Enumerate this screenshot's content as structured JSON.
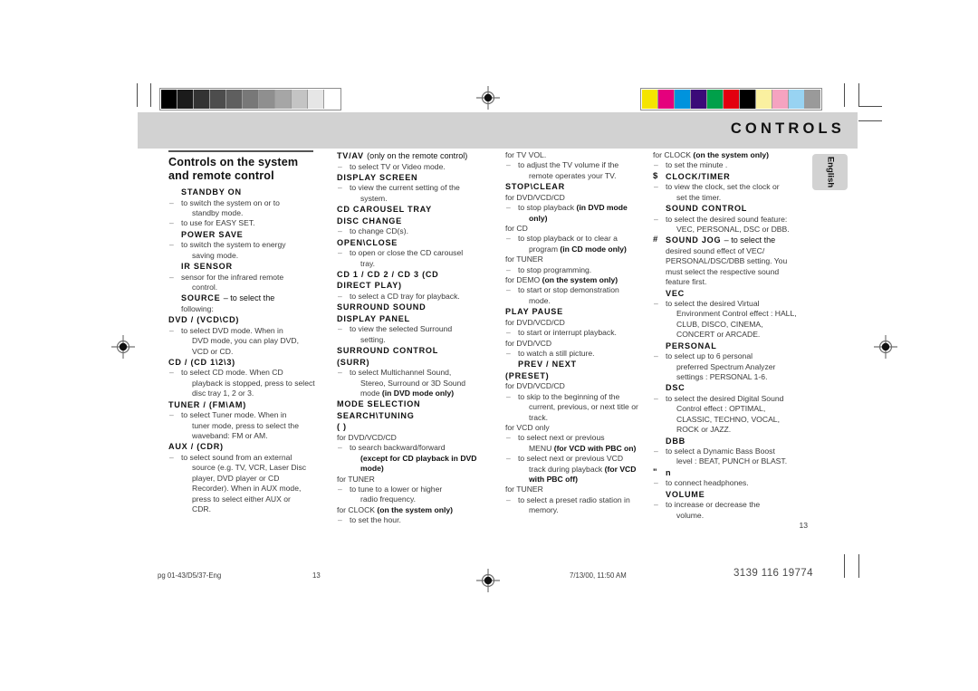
{
  "document": {
    "band_title": "CONTROLS",
    "language_tab": "English",
    "page_number_text": "13"
  },
  "calibration": {
    "grayscale_swatches": [
      "#000000",
      "#1b1b1b",
      "#333333",
      "#4d4d4d",
      "#5f5f5f",
      "#787878",
      "#8f8f8f",
      "#a6a6a6",
      "#c4c4c4",
      "#e6e6e6",
      "#ffffff"
    ],
    "color_swatches": [
      "#f5e400",
      "#e5007d",
      "#0093dd",
      "#3b0a78",
      "#00a04a",
      "#e3000f",
      "#000000",
      "#faf0a0",
      "#f5a3c0",
      "#98d3f2",
      "#9a9a9a"
    ]
  },
  "section": {
    "title_line1": "Controls on the system",
    "title_line2": "and remote control"
  },
  "col1": {
    "standby_term": "STANDBY ON",
    "standby_b1": "to switch the system on or to",
    "standby_b1b": "standby mode.",
    "standby_b2": "to use for EASY SET.",
    "powersave_term": "POWER SAVE",
    "powersave_b1": "to switch the system to energy",
    "powersave_b1b": "saving mode.",
    "irsensor_term": "IR SENSOR",
    "irsensor_b1": "sensor for the infrared remote",
    "irsensor_b1b": "control.",
    "source_term": "SOURCE",
    "source_tail": "– to select the",
    "source_cont": "following:",
    "dvd_term": "DVD / (VCD\\CD)",
    "dvd_b1": "to select DVD mode. When in",
    "dvd_b1b": "DVD mode, you can play DVD,",
    "dvd_b1c": "VCD or CD.",
    "cd_term": "CD / (CD 1\\2\\3)",
    "cd_b1": "to select CD mode. When CD",
    "cd_b1b": "playback is stopped, press to select",
    "cd_b1c": "disc tray 1, 2 or 3.",
    "tuner_term": "TUNER / (FM\\AM)",
    "tuner_b1": "to select Tuner mode. When in",
    "tuner_b1b": "tuner mode, press to select the",
    "tuner_b1c": "waveband: FM or AM.",
    "aux_term": "AUX / (CDR)",
    "aux_b1": "to select sound from an external",
    "aux_b1b": "source (e.g. TV, VCR, Laser Disc",
    "aux_b1c": "player, DVD player or CD",
    "aux_b1d": "Recorder). When in AUX mode,",
    "aux_b1e": "press to select either AUX or",
    "aux_b1f": "CDR."
  },
  "col2": {
    "tvav_term": "TV/AV",
    "tvav_tail": "(only on the remote control)",
    "tvav_b1": "to select TV or Video mode.",
    "display_screen_term": "DISPLAY SCREEN",
    "display_screen_b1": "to view the current setting of the",
    "display_screen_b1b": "system.",
    "carousel_term": "CD CAROUSEL TRAY",
    "discchange_term": "DISC CHANGE",
    "discchange_b1": "to change CD(s).",
    "openclose_term": "OPEN\\CLOSE",
    "openclose_b1": "to open or close the CD carousel",
    "openclose_b1b": "tray.",
    "cd123_term": "CD 1 / CD 2 / CD 3 (CD",
    "cd123_term2": "DIRECT PLAY)",
    "cd123_b1": "to select a CD tray for playback.",
    "surr_panel_term": "SURROUND SOUND",
    "surr_panel_term2": "DISPLAY PANEL",
    "surr_panel_b1": "to view the selected Surround",
    "surr_panel_b1b": "setting.",
    "surr_ctrl_term": "SURROUND CONTROL",
    "surr_ctrl_term2": "(SURR)",
    "surr_ctrl_b1": "to select Multichannel Sound,",
    "surr_ctrl_b1b": "Stereo, Surround or 3D Sound",
    "surr_ctrl_b1c": "mode",
    "surr_ctrl_b1c_em": "(in DVD mode only)",
    "mode_sel_term": "MODE SELECTION",
    "search_term": "SEARCH\\TUNING",
    "search_glyphs": "(        )",
    "search_for1": "for DVD/VCD/CD",
    "search_b1": "to search backward/forward",
    "search_b1_em": "(except for CD playback in DVD",
    "search_b1_em2": "mode)",
    "search_for2": "for TUNER",
    "search_b2": "to tune to a lower or higher",
    "search_b2b": "radio frequency.",
    "search_for3": "for CLOCK",
    "search_for3_em": "(on the system only)",
    "search_b3": "to set the hour."
  },
  "col3": {
    "vol_for": "for TV VOL.",
    "vol_b1": "to adjust the TV volume if the",
    "vol_b1b": "remote operates your TV.",
    "stop_term": "STOP\\CLEAR",
    "stop_for1": "for DVD/VCD/CD",
    "stop_b1": "to stop playback",
    "stop_b1_em": "(in DVD mode",
    "stop_b1_em2": "only)",
    "stop_for2": "for CD",
    "stop_b2": "to stop playback or to clear a",
    "stop_b2b": "program",
    "stop_b2b_em": "(in CD mode only)",
    "stop_for3": "for TUNER",
    "stop_b3": "to stop programming.",
    "stop_for4": "for DEMO",
    "stop_for4_em": "(on the system only)",
    "stop_b4": "to start or stop demonstration",
    "stop_b4b": "mode.",
    "play_term": "PLAY PAUSE",
    "play_for1": "for DVD/VCD/CD",
    "play_b1": "to start or interrupt playback.",
    "play_for2": "for DVD/VCD",
    "play_b2": "to watch a still picture.",
    "prev_term": "PREV / NEXT",
    "prev_term2": "(PRESET)",
    "prev_for1": "for DVD/VCD/CD",
    "prev_b1": "to skip to the beginning of the",
    "prev_b1b": "current, previous, or next title or",
    "prev_b1c": "track.",
    "prev_for2": "for VCD only",
    "prev_b2": "to select next or previous",
    "prev_b2b": "MENU",
    "prev_b2b_em": "(for VCD with PBC on)",
    "prev_b3": "to select next or previous VCD",
    "prev_b3b": "track during playback",
    "prev_b3b_em": "(for VCD",
    "prev_b3c_em": "with PBC off)",
    "prev_for3": "for TUNER",
    "prev_b4": "to select a preset radio station in",
    "prev_b4b": "memory."
  },
  "col4": {
    "clock_for": "for CLOCK",
    "clock_for_em": "(on the system only)",
    "clock_b0": "to set the minute .",
    "clock_glyph": "$",
    "clock_term": "CLOCK/TIMER",
    "clock_b1": "to view the clock, set the clock or",
    "clock_b1b": "set the timer.",
    "soundctrl_term": "SOUND CONTROL",
    "soundctrl_b1": "to select the desired sound feature:",
    "soundctrl_b1b": "VEC, PERSONAL, DSC or DBB.",
    "soundjog_glyph": "#",
    "soundjog_term": "SOUND JOG",
    "soundjog_tail": "– to select the",
    "soundjog_c1": "desired sound effect of VEC/",
    "soundjog_c2": "PERSONAL/DSC/DBB setting. You",
    "soundjog_c3": "must select the respective sound",
    "soundjog_c4": "feature first.",
    "vec_term": "VEC",
    "vec_b1": "to select the desired Virtual",
    "vec_b1b": "Environment Control effect : HALL,",
    "vec_b1c": "CLUB, DISCO, CINEMA,",
    "vec_b1d": "CONCERT or ARCADE.",
    "personal_term": "PERSONAL",
    "personal_b1": "to select up to 6 personal",
    "personal_b1b": "preferred Spectrum Analyzer",
    "personal_b1c": "settings : PERSONAL 1-6.",
    "dsc_term": "DSC",
    "dsc_b1": "to select the desired Digital Sound",
    "dsc_b1b": "Control effect : OPTIMAL,",
    "dsc_b1c": "CLASSIC, TECHNO, VOCAL,",
    "dsc_b1d": "ROCK or JAZZ.",
    "dbb_term": "DBB",
    "dbb_b1": "to select a Dynamic Bass Boost",
    "dbb_b1b": "level : BEAT, PUNCH or BLAST.",
    "phones_glyph": "\"",
    "phones_term": "n",
    "phones_b1": "to connect headphones.",
    "volume_term": "VOLUME",
    "volume_b1": "to increase or decrease the",
    "volume_b1b": "volume."
  },
  "footer": {
    "file_ref": "pg 01-43/D5/37-Eng",
    "page": "13",
    "timestamp": "7/13/00, 11:50 AM",
    "code": "3139 116 19774"
  }
}
